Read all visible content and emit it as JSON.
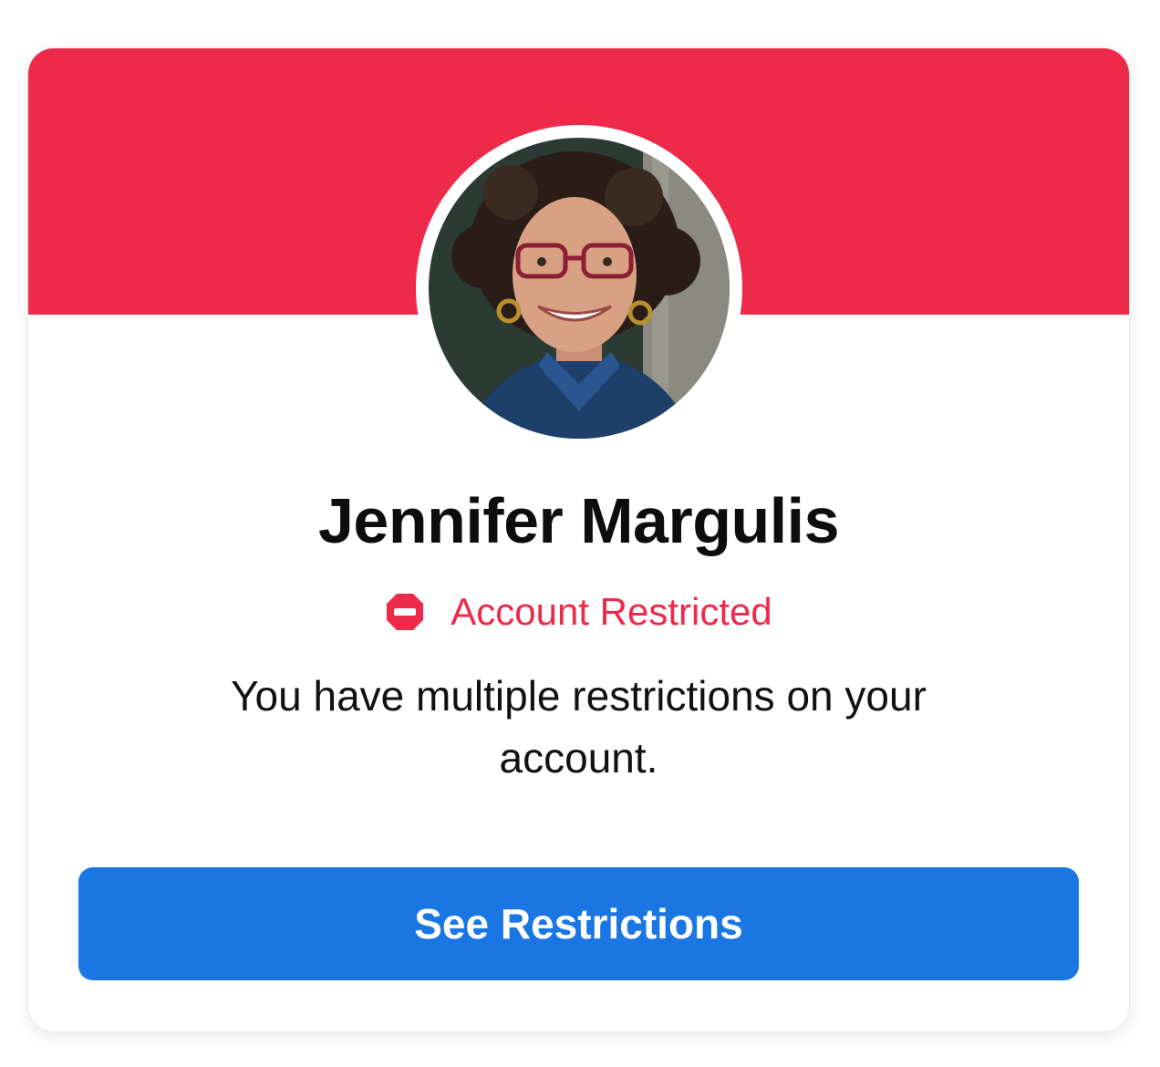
{
  "profile": {
    "name": "Jennifer Margulis",
    "avatar_alt": "Profile photo"
  },
  "status": {
    "icon": "restricted-icon",
    "label": "Account Restricted"
  },
  "message": "You have multiple restrictions on your account.",
  "actions": {
    "see_restrictions_label": "See Restrictions"
  },
  "colors": {
    "banner": "#ee2a4a",
    "status": "#ee2a4a",
    "button": "#1a76e3"
  }
}
